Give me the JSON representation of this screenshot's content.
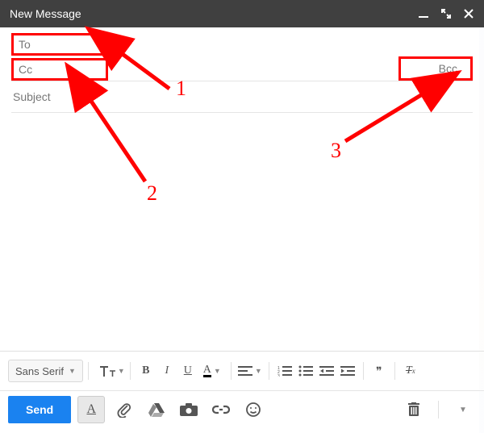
{
  "titlebar": {
    "title": "New Message"
  },
  "fields": {
    "to_label": "To",
    "cc_label": "Cc",
    "bcc_label": "Bcc",
    "subject_placeholder": "Subject"
  },
  "format_toolbar": {
    "font_name": "Sans Serif",
    "size_glyph_large": "T",
    "size_glyph_small": "T",
    "bold": "B",
    "italic": "I",
    "underline": "U",
    "text_color_glyph": "A",
    "quote_glyph": "❝❞",
    "clear_format_glyph": "Tx"
  },
  "send_toolbar": {
    "send_label": "Send",
    "format_toggle_glyph": "A"
  },
  "annotations": {
    "label_1": "1",
    "label_2": "2",
    "label_3": "3"
  },
  "colors": {
    "accent_red": "#ff0000",
    "send_blue": "#1a82f0",
    "titlebar_bg": "#404040"
  }
}
